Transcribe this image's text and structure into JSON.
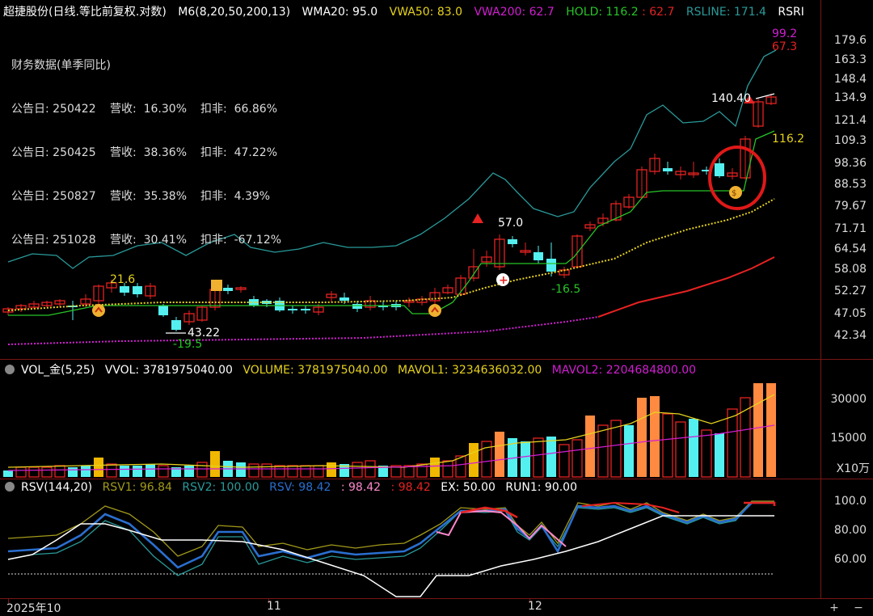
{
  "header": {
    "title": "超捷股份(日线.等比前复权.对数)",
    "ma_name": "M6(8,20,50,200,13)",
    "items": [
      {
        "text": "WMA20: 95.0",
        "color": "#ffffff"
      },
      {
        "text": "VWA50: 83.0",
        "color": "#e6d21e"
      },
      {
        "text": "VWA200: 62.7",
        "color": "#d21ed2"
      },
      {
        "text": "HOLD: 116.2",
        "color": "#27c427"
      },
      {
        "text": ": 62.7",
        "color": "#e62222"
      },
      {
        "text": "RSLINE: 171.4",
        "color": "#2a9a9a"
      },
      {
        "text": "RSRI",
        "color": "#ffffff"
      }
    ]
  },
  "financials": {
    "title": "财务数据(单季同比)",
    "rows": [
      {
        "date": "公告日: 250422",
        "rev": "营收:  16.30%",
        "np": "扣非:  66.86%"
      },
      {
        "date": "公告日: 250425",
        "rev": "营收:  38.36%",
        "np": "扣非:  47.22%"
      },
      {
        "date": "公告日: 250827",
        "rev": "营收:  35.38%",
        "np": "扣非:  4.39%"
      },
      {
        "date": "公告日: 251028",
        "rev": "营收:  30.41%",
        "np": "扣非:  -67.12%"
      }
    ]
  },
  "price_axis": [
    "179.6",
    "163.3",
    "148.4",
    "134.9",
    "121.4",
    "109.3",
    "98.36",
    "88.53",
    "79.67",
    "71.71",
    "64.54",
    "58.08",
    "52.27",
    "47.05",
    "42.34"
  ],
  "annotations": {
    "top_val_1": "99.2",
    "top_val_2": "67.3",
    "high_label": "140.40",
    "hold_label": "116.2",
    "peak_label": "57.0",
    "low_label_1": "21.6",
    "low_label_2": "43.22",
    "low_label_3": "-19.5",
    "low_label_4": "-16.5"
  },
  "volume": {
    "header": [
      "VOL_金(5,25)",
      "VVOL: 3781975040.00",
      "VOLUME: 3781975040.00",
      "MAVOL1: 3234636032.00",
      "MAVOL2: 2204684800.00"
    ],
    "header_colors": [
      "#ffffff",
      "#ffffff",
      "#e6d21e",
      "#e6d21e",
      "#d21ed2"
    ],
    "axis": [
      "30000",
      "15000"
    ],
    "unit": "X10万"
  },
  "rsv": {
    "header": [
      "RSV(144,20)",
      "RSV1: 96.84",
      "RSV2: 100.00",
      "RSV: 98.42",
      ": 98.42",
      ": 98.42",
      "EX: 50.00",
      "RUN1: 90.00"
    ],
    "header_colors": [
      "#ffffff",
      "#a29a1a",
      "#2a9a9a",
      "#2a6fd0",
      "#ff88cc",
      "#e62222",
      "#ffffff",
      "#ffffff"
    ],
    "axis": [
      "100.0",
      "80.00",
      "60.00"
    ]
  },
  "xaxis": {
    "labels": [
      "2025年10",
      "11",
      "12"
    ]
  },
  "buttons": {
    "plus": "+",
    "minus": "−"
  },
  "colors": {
    "up": "#e62222",
    "down": "#54f0f0",
    "bg": "#000000",
    "grid": "#7a1616"
  }
}
